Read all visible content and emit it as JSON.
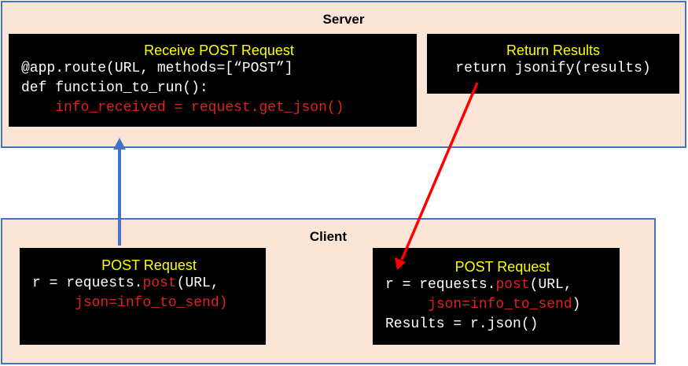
{
  "server": {
    "title": "Server",
    "receive_box": {
      "title": "Receive POST Request",
      "line1": "@app.route(URL, methods=[“POST”]",
      "line2": "def function_to_run():",
      "line3_indent": "    ",
      "line3": "info_received = request.get_json()"
    },
    "return_box": {
      "title": "Return Results",
      "line1": "return jsonify(results)"
    }
  },
  "client": {
    "title": "Client",
    "left_box": {
      "title": "POST Request",
      "line1_pre": "r = requests.",
      "line1_post": "post",
      "line1_rest": "(URL,",
      "line2_indent": "     ",
      "line2": "json=info_to_send)"
    },
    "right_box": {
      "title": "POST Request",
      "line1_pre": "r = requests.",
      "line1_post": "post",
      "line1_rest": "(URL,",
      "line2_indent": "     ",
      "line2_red": "json=info_to_send",
      "line2_end": ")",
      "line3": "Results = r.json()"
    }
  },
  "colors": {
    "panel_fill": "#fbe5d6",
    "panel_border": "#4472c4",
    "box_fill": "#000000",
    "box_title": "#ffff00",
    "code_text": "#ffffff",
    "highlight_red": "#e02020",
    "arrow_up": "#4472c4",
    "arrow_down": "#ff0000"
  }
}
